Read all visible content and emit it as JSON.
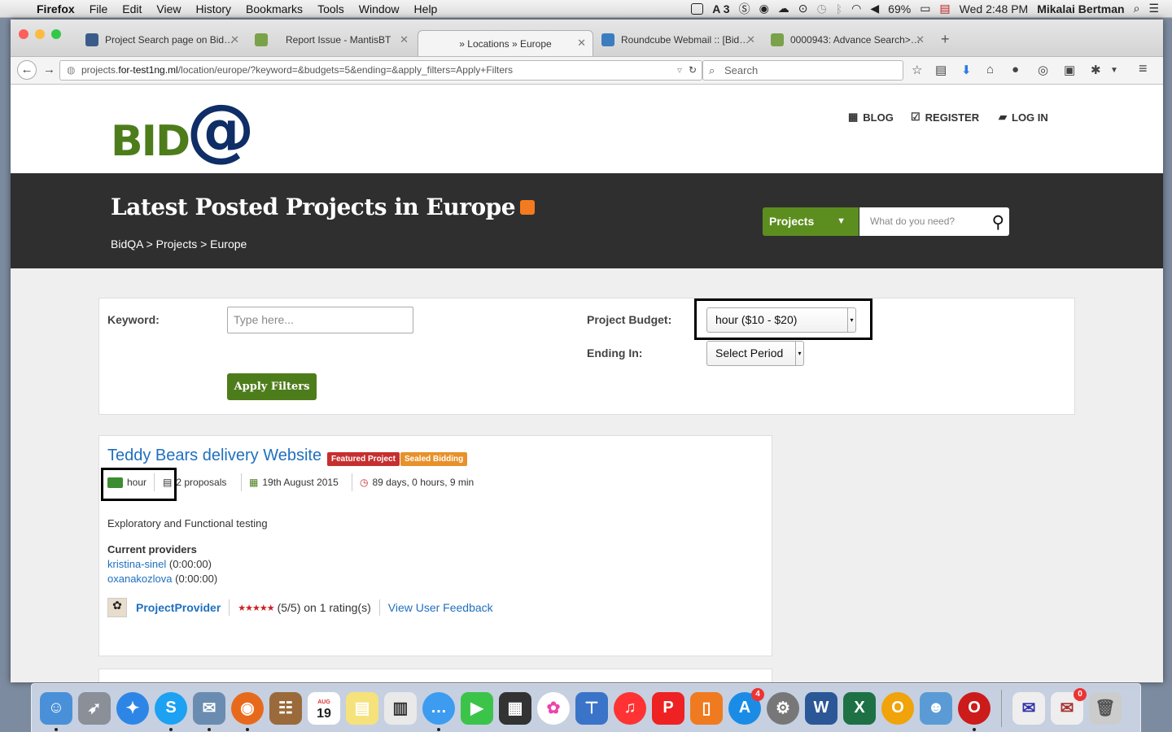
{
  "menubar": {
    "app": "Firefox",
    "items": [
      "File",
      "Edit",
      "View",
      "History",
      "Bookmarks",
      "Tools",
      "Window",
      "Help"
    ],
    "battery": "69%",
    "clock": "Wed 2:48 PM",
    "user": "Mikalai Bertman",
    "adobe_count": "3"
  },
  "tabs": [
    {
      "label": "Project Search page on Bid…",
      "active": false
    },
    {
      "label": "Report Issue - MantisBT",
      "active": false
    },
    {
      "label": "» Locations » Europe",
      "active": true
    },
    {
      "label": "Roundcube Webmail :: [Bid…",
      "active": false
    },
    {
      "label": "0000943: Advance Search>…",
      "active": false
    }
  ],
  "url": {
    "prefix": "projects.",
    "host": "for-test1ng.ml",
    "path": "/location/europe/?keyword=&budgets=5&ending=&apply_filters=Apply+Filters"
  },
  "browser_search_placeholder": "Search",
  "site": {
    "logo_left": "BID",
    "logo_right": "@",
    "nav": {
      "blog": "BLOG",
      "register": "REGISTER",
      "login": "LOG IN"
    },
    "heading": "Latest Posted Projects in Europe",
    "breadcrumb": "BidQA > Projects > Europe",
    "projects_dropdown": "Projects",
    "search_placeholder": "What do you need?"
  },
  "filters": {
    "keyword_label": "Keyword:",
    "keyword_placeholder": "Type here...",
    "budget_label": "Project Budget:",
    "budget_value": "hour ($10 - $20)",
    "ending_label": "Ending In:",
    "ending_value": "Select Period",
    "apply_label": "Apply Filters"
  },
  "project": {
    "title": "Teddy Bears delivery Website",
    "badge_featured": "Featured Project",
    "badge_sealed": "Sealed Bidding",
    "budget": "hour",
    "proposals": "2 proposals",
    "date": "19th August 2015",
    "time_left": "89 days, 0 hours, 9 min",
    "description": "Exploratory and Functional testing",
    "providers_heading": "Current providers",
    "providers": [
      {
        "name": "kristina-sinel",
        "time": "(0:00:00)"
      },
      {
        "name": "oxanakozlova",
        "time": "(0:00:00)"
      }
    ],
    "owner": "ProjectProvider",
    "rating": 5,
    "rating_text": "(5/5) on 1 rating(s)",
    "feedback_link": "View User Feedback"
  },
  "dock": {
    "calendar_month": "AUG",
    "calendar_day": "19",
    "appstore_badge": "4",
    "mail_badge": "0"
  },
  "colors": {
    "brand_green": "#4d7d1b",
    "brand_navy": "#0f2d66",
    "link_blue": "#1f6fbf",
    "banner_dark": "#2f2f2f",
    "featured_red": "#c62f2f",
    "sealed_orange": "#e8912a"
  }
}
